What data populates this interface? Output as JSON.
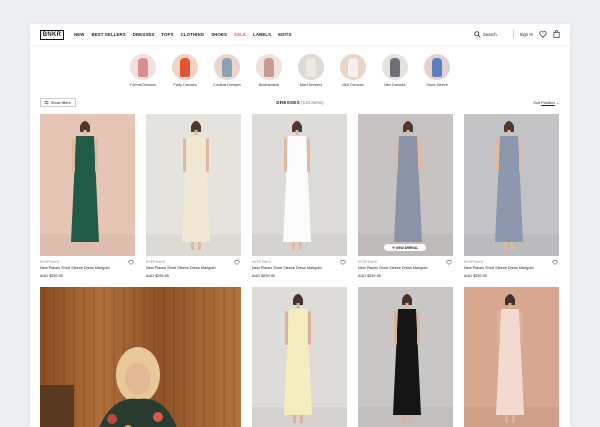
{
  "header": {
    "logo": "BNKR",
    "nav": [
      "NEW",
      "BEST SELLERS",
      "DRESSES",
      "TOPS",
      "CLOTHING",
      "SHOES",
      "SALE",
      "LABELS",
      "EDITS"
    ],
    "search_label": "Search",
    "signin_label": "Sign In",
    "icons": [
      "search-icon",
      "heart-icon",
      "bag-icon"
    ]
  },
  "categories": [
    {
      "label": "Formal Dresses",
      "dress_color": "#d88f90",
      "bg": "#f1e0dc"
    },
    {
      "label": "Party Dresses",
      "dress_color": "#e2552f",
      "bg": "#f4d3c6"
    },
    {
      "label": "Cocktail Dresses",
      "dress_color": "#8ea2b5",
      "bg": "#e8d6cf"
    },
    {
      "label": "Bridesmaids",
      "dress_color": "#c89c92",
      "bg": "#efe1dc"
    },
    {
      "label": "Maxi Dresses",
      "dress_color": "#ece9e3",
      "bg": "#ddd9d4"
    },
    {
      "label": "Midi Dresses",
      "dress_color": "#f4f1ec",
      "bg": "#e9d6c8"
    },
    {
      "label": "Mini Dresses",
      "dress_color": "#6f6f7a",
      "bg": "#e6e2de"
    },
    {
      "label": "Short-Sleeve",
      "dress_color": "#5c7fbf",
      "bg": "#e3d3cc"
    }
  ],
  "toolbar": {
    "filters_label": "Show filters",
    "heading": "DRESSES",
    "count": "(134 items)",
    "sort_prefix": "Sort",
    "sort_value": "Position"
  },
  "products": [
    {
      "brand": "KEEPSAKE",
      "name": "New Places Short Sleeve Dress Marigold",
      "price": "AUD $299.95",
      "bg": "#e7c5b5",
      "dress": "#1f5b47",
      "badge": ""
    },
    {
      "brand": "KEEPSAKE",
      "name": "New Places Short Sleeve Dress Marigold",
      "price": "AUD $299.95",
      "bg": "#e5e3de",
      "dress": "#efe8d3",
      "badge": ""
    },
    {
      "brand": "KEEPSAKE",
      "name": "New Places Short Sleeve Dress Marigold",
      "price": "AUD $299.95",
      "bg": "#dedcd9",
      "dress": "#fbfbfb",
      "badge": ""
    },
    {
      "brand": "KEEPSAKE",
      "name": "New Places Short Sleeve Dress Marigold",
      "price": "AUD $299.95",
      "bg": "#c6c3c2",
      "dress": "#8a93a8",
      "badge": "NEW ARRIVAL"
    },
    {
      "brand": "KEEPSAKE",
      "name": "New Places Short Sleeve Dress Marigold",
      "price": "AUD $299.95",
      "bg": "#c3c3c6",
      "dress": "#8d97ad",
      "badge": ""
    }
  ],
  "products_row2": [
    {
      "bg": "#9a5a2a",
      "dress": "#2a3b2f"
    },
    {
      "bg": "#dedcd9",
      "dress": "#f5ecbf"
    },
    {
      "bg": "#c9c7c6",
      "dress": "#151515"
    },
    {
      "bg": "#d8a78f",
      "dress": "#f3d9cf"
    }
  ],
  "colors": {
    "sale": "#e0523d",
    "badge_dot": "#e0523d"
  }
}
